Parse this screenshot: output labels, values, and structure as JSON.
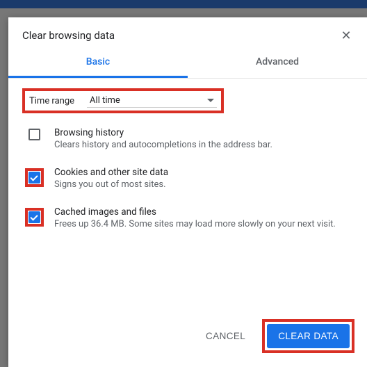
{
  "dialog": {
    "title": "Clear browsing data",
    "tabs": {
      "basic": "Basic",
      "advanced": "Advanced"
    },
    "time": {
      "label": "Time range",
      "value": "All time"
    },
    "options": [
      {
        "title": "Browsing history",
        "desc": "Clears history and autocompletions in the address bar.",
        "checked": false,
        "highlight": false
      },
      {
        "title": "Cookies and other site data",
        "desc": "Signs you out of most sites.",
        "checked": true,
        "highlight": true
      },
      {
        "title": "Cached images and files",
        "desc": "Frees up 36.4 MB. Some sites may load more slowly on your next visit.",
        "checked": true,
        "highlight": true
      }
    ],
    "buttons": {
      "cancel": "CANCEL",
      "clear": "CLEAR DATA"
    }
  }
}
